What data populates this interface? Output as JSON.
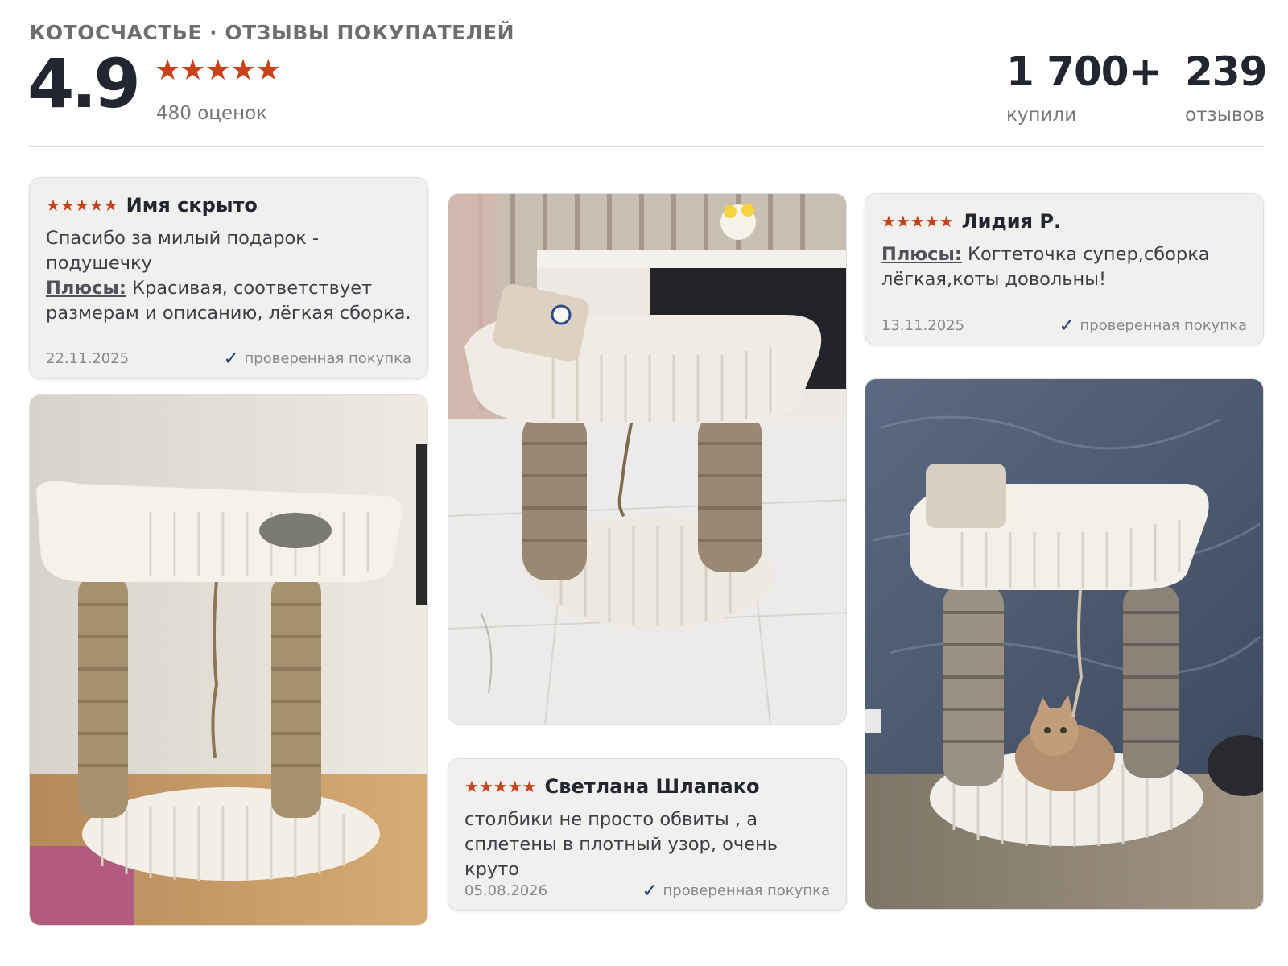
{
  "header": {
    "brand": "КОТОСЧАСТЬЕ · ОТЗЫВЫ ПОКУПАТЕЛЕЙ",
    "rating": "4.9",
    "stars": "★★★★★",
    "rating_count": "480 оценок",
    "stats": [
      {
        "value": "1 700+",
        "label": "купили"
      },
      {
        "value": "239",
        "label": "отзывов"
      }
    ]
  },
  "reviews": [
    {
      "stars": "★★★★★",
      "author": "Имя скрыто",
      "comment": "Спасибо за милый подарок - подушечку",
      "pros_label": "Плюсы:",
      "pros": "Красивая, соответствует размерам и описанию, лёгкая сборка.",
      "date": "22.11.2025",
      "verified": "проверенная покупка"
    },
    {
      "stars": "★★★★★",
      "author": "Лидия Р.",
      "pros_label": "Плюсы:",
      "pros": "Когтеточка супер,сборка лёгкая,коты довольны!",
      "date": "13.11.2025",
      "verified": "проверенная покупка"
    },
    {
      "stars": "★★★★★",
      "author": "Светлана Шлапако",
      "comment": "столбики не просто обвиты , а сплетены в плотный узор, очень круто",
      "date": "05.08.2026",
      "verified": "проверенная покупка"
    }
  ],
  "colors": {
    "star": "#c8421b",
    "check": "#1e3d7a",
    "card_bg": "#f1f0ef"
  },
  "icons": [
    "star-icon",
    "checkmark-icon"
  ]
}
